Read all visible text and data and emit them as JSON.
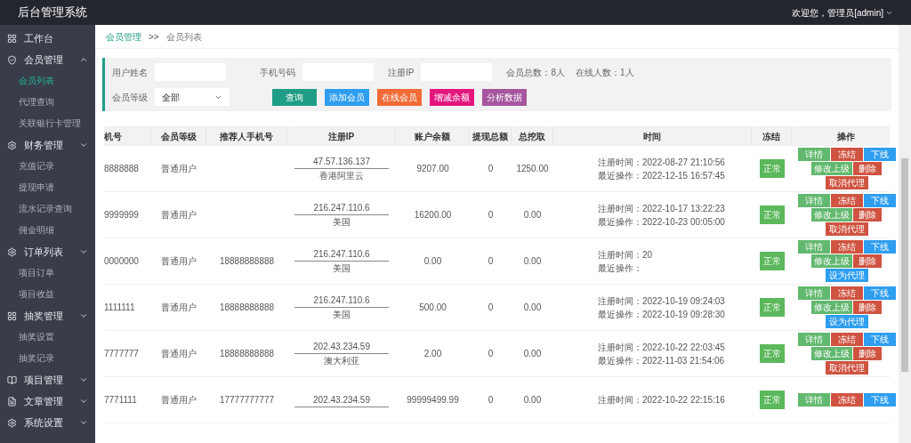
{
  "header": {
    "title": "后台管理系统",
    "user": "欢迎您，管理员[admin]"
  },
  "sidebar": [
    {
      "label": "工作台"
    },
    {
      "label": "会员管理",
      "expanded": true,
      "children": [
        {
          "label": "会员列表",
          "selected": true
        },
        {
          "label": "代理查询",
          "selected": false
        },
        {
          "label": "关联银行卡管理",
          "selected": false
        }
      ]
    },
    {
      "label": "财务管理",
      "expanded": false,
      "children": [
        {
          "label": "充值记录",
          "selected": false
        },
        {
          "label": "提现申请",
          "selected": false
        },
        {
          "label": "流水记录查询",
          "selected": false
        },
        {
          "label": "佣金明细",
          "selected": false
        }
      ]
    },
    {
      "label": "订单列表",
      "expanded": false,
      "children": [
        {
          "label": "项目订单",
          "selected": false
        },
        {
          "label": "项目收益",
          "selected": false
        }
      ]
    },
    {
      "label": "抽奖管理",
      "expanded": false,
      "children": [
        {
          "label": "抽奖设置",
          "selected": false
        },
        {
          "label": "抽奖记录",
          "selected": false
        }
      ]
    },
    {
      "label": "项目管理",
      "expanded": false
    },
    {
      "label": "文章管理",
      "expanded": false
    },
    {
      "label": "系统设置",
      "expanded": false
    }
  ],
  "breadcrumb": {
    "parent": "会员管理",
    "separator": ">>",
    "current": "会员列表"
  },
  "filters": {
    "username_label": "用户姓名",
    "phone_label": "手机号码",
    "ip_label": "注册IP",
    "total": "会员总数：8人",
    "online": "在线人数：1人",
    "level_label": "会员等级",
    "level_value": "全部",
    "buttons": [
      {
        "label": "查询",
        "color": "#1f9d86"
      },
      {
        "label": "添加会员",
        "color": "#2e9ef0"
      },
      {
        "label": "在线会员",
        "color": "#f26a36"
      },
      {
        "label": "增减余额",
        "color": "#e3167f"
      },
      {
        "label": "分析数据",
        "color": "#a5569f"
      }
    ]
  },
  "table": {
    "columns": [
      "机号",
      "会员等级",
      "推荐人手机号",
      "注册IP",
      "账户余额",
      "提现总额",
      "总挖取",
      "时间",
      "冻结",
      "操作"
    ],
    "rows": [
      {
        "phone": "8888888",
        "level": "普通用户",
        "referrer": "",
        "ip": "47.57.136.137",
        "location": "香港阿里云",
        "balance": "9207.00",
        "withdrawn": "0",
        "mined": "1250.00",
        "reg_label": "注册时间：",
        "reg_time": "2022-08-27 21:10:56",
        "last_label": "最近操作：",
        "last_time": "2022-12-15 16:57:45",
        "status": "正常",
        "actions": [
          {
            "label": "详情",
            "color": "#62b86f"
          },
          {
            "label": "冻结",
            "color": "#cf5340"
          },
          {
            "label": "下线",
            "color": "#2e9ef0"
          },
          {
            "label": "修改上级",
            "color": "#62b86f"
          },
          {
            "label": "删除",
            "color": "#cf5340"
          },
          {
            "label": "取消代理",
            "color": "#cf5340"
          }
        ]
      },
      {
        "phone": "9999999",
        "level": "普通用户",
        "referrer": "",
        "ip": "216.247.110.6",
        "location": "美国",
        "balance": "16200.00",
        "withdrawn": "0",
        "mined": "0.00",
        "reg_label": "注册时间：",
        "reg_time": "2022-10-17 13:22:23",
        "last_label": "最近操作：",
        "last_time": "2022-10-23 00:05:00",
        "status": "正常",
        "actions": [
          {
            "label": "详情",
            "color": "#62b86f"
          },
          {
            "label": "冻结",
            "color": "#cf5340"
          },
          {
            "label": "下线",
            "color": "#2e9ef0"
          },
          {
            "label": "修改上级",
            "color": "#62b86f"
          },
          {
            "label": "删除",
            "color": "#cf5340"
          },
          {
            "label": "取消代理",
            "color": "#cf5340"
          }
        ]
      },
      {
        "phone": "0000000",
        "level": "普通用户",
        "referrer": "18888888888",
        "ip": "216.247.110.6",
        "location": "美国",
        "balance": "0.00",
        "withdrawn": "0",
        "mined": "0.00",
        "reg_label": "注册时间：",
        "reg_time": "20",
        "last_label": "最近操作：",
        "status": "正常",
        "actions": [
          {
            "label": "详情",
            "color": "#62b86f"
          },
          {
            "label": "冻结",
            "color": "#cf5340"
          },
          {
            "label": "下线",
            "color": "#2e9ef0"
          },
          {
            "label": "修改上级",
            "color": "#62b86f"
          },
          {
            "label": "删除",
            "color": "#cf5340"
          },
          {
            "label": "设为代理",
            "color": "#2e9ef0"
          }
        ]
      },
      {
        "phone": "1111111",
        "level": "普通用户",
        "referrer": "18888888888",
        "ip": "216.247.110.6",
        "location": "美国",
        "balance": "500.00",
        "withdrawn": "0",
        "mined": "0.00",
        "reg_label": "注册时间：",
        "reg_time": "2022-10-19 09:24:03",
        "last_label": "最近操作：",
        "last_time": "2022-10-19 09:28:30",
        "status": "正常",
        "actions": [
          {
            "label": "详情",
            "color": "#62b86f"
          },
          {
            "label": "冻结",
            "color": "#cf5340"
          },
          {
            "label": "下线",
            "color": "#2e9ef0"
          },
          {
            "label": "修改上级",
            "color": "#62b86f"
          },
          {
            "label": "删除",
            "color": "#cf5340"
          },
          {
            "label": "设为代理",
            "color": "#2e9ef0"
          }
        ]
      },
      {
        "phone": "7777777",
        "level": "普通用户",
        "referrer": "18888888888",
        "ip": "202.43.234.59",
        "location": "澳大利亚",
        "balance": "2.00",
        "withdrawn": "0",
        "mined": "0.00",
        "reg_label": "注册时间：",
        "reg_time": "2022-10-22 22:03:45",
        "last_label": "最近操作：",
        "last_time": "2022-11-03 21:54:06",
        "status": "正常",
        "actions": [
          {
            "label": "详情",
            "color": "#62b86f"
          },
          {
            "label": "冻结",
            "color": "#cf5340"
          },
          {
            "label": "下线",
            "color": "#2e9ef0"
          },
          {
            "label": "修改上级",
            "color": "#62b86f"
          },
          {
            "label": "删除",
            "color": "#cf5340"
          },
          {
            "label": "取消代理",
            "color": "#cf5340"
          }
        ]
      },
      {
        "phone": "7771111",
        "level": "普通用户",
        "referrer": "17777777777",
        "ip": "202.43.234.59",
        "balance": "99999499.99",
        "withdrawn": "0",
        "mined": "0.00",
        "reg_label": "注册时间：",
        "reg_time": "2022-10-22 22:15:16",
        "status": "正常",
        "actions": [
          {
            "label": "详情",
            "color": "#62b86f"
          },
          {
            "label": "冻结",
            "color": "#cf5340"
          },
          {
            "label": "下线",
            "color": "#2e9ef0"
          }
        ]
      }
    ]
  }
}
